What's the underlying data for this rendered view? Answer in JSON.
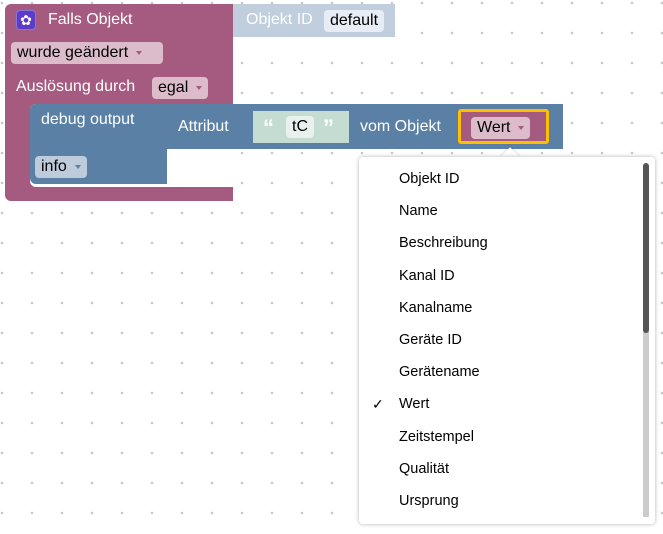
{
  "event_block": {
    "icon": "gear-icon",
    "title": "Falls Objekt",
    "object_id_label": "Objekt ID",
    "object_id_value": "default",
    "change_dropdown": "wurde geändert",
    "trigger_label": "Auslösung durch",
    "trigger_dropdown": "egal",
    "color": "#a55b80"
  },
  "debug_block": {
    "label": "debug output",
    "level_dropdown": "info",
    "color": "#5b80a5"
  },
  "attribute_block": {
    "label": "Attribut",
    "text_value": "tC",
    "open_quote": "“",
    "close_quote": "”",
    "object_label": "vom Objekt",
    "selected": "Wert"
  },
  "dropdown_menu": {
    "items": [
      "Objekt ID",
      "Name",
      "Beschreibung",
      "Kanal ID",
      "Kanalname",
      "Geräte ID",
      "Gerätename",
      "Wert",
      "Zeitstempel",
      "Qualität",
      "Ursprung"
    ],
    "checked_index": 7,
    "check_mark": "✓"
  },
  "colors": {
    "highlight": "#fcc000",
    "text_block": "#c5dcd2",
    "object_id_block": "#c0cedd"
  }
}
